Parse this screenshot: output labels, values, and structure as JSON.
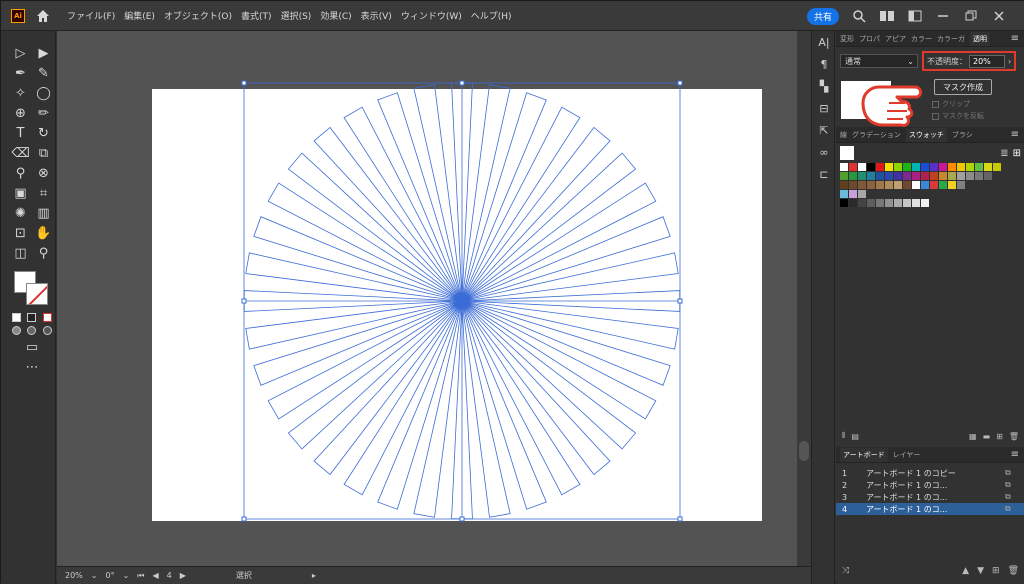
{
  "menubar": {
    "logo": "Ai",
    "items": [
      "ファイル(F)",
      "編集(E)",
      "オブジェクト(O)",
      "書式(T)",
      "選択(S)",
      "効果(C)",
      "表示(V)",
      "ウィンドウ(W)",
      "ヘルプ(H)"
    ],
    "share": "共有"
  },
  "transparency_panel": {
    "tabs": [
      "変形",
      "プロパ",
      "アピア",
      "カラー",
      "カラーガ",
      "透明"
    ],
    "active_tab": "透明",
    "blend_mode": "通常",
    "opacity_label": "不透明度：",
    "opacity_value": "20%",
    "mask_button": "マスク作成",
    "clip_label": "クリップ",
    "invert_mask_label": "マスクを反転"
  },
  "swatches_panel": {
    "tabs": [
      "線",
      "グラデーション",
      "スウォッチ",
      "ブラシ"
    ],
    "active_tab": "スウォッチ",
    "rows": [
      [
        "#ffffff",
        "#e03030",
        "#ffffff",
        "#000000",
        "#e01818",
        "#f7e000",
        "#8fd400",
        "#18b418",
        "#00b4b4",
        "#1a4ed8",
        "#5a2ec8",
        "#c81898",
        "#ff8a00",
        "#f0c800",
        "#b4d400",
        "#60c040",
        "#d8d818",
        "#c8c800"
      ],
      [
        "#50a030",
        "#289840",
        "#209070",
        "#2080a0",
        "#2050a0",
        "#2848b0",
        "#4030a0",
        "#802890",
        "#a82080",
        "#b02050",
        "#c04020",
        "#c88828",
        "#a8a850",
        "#a0a0a0",
        "#8c8c8c",
        "#787878",
        "#646464"
      ],
      [
        "#604020",
        "#6c4a2c",
        "#80583a",
        "#8c6240",
        "#a07848",
        "#b08a58",
        "#c0a070",
        "#704830",
        "#ffffff",
        "#3a88d8",
        "#d83a3a",
        "#28a848",
        "#f0d020",
        "#808080"
      ],
      [
        "#6abadc",
        "#c8a0e0",
        "#a8a8a8"
      ],
      [
        "#000000",
        "#2a2a2a",
        "#444444",
        "#5e5e5e",
        "#787878",
        "#929292",
        "#acacac",
        "#c6c6c6",
        "#e0e0e0",
        "#f0f0f0"
      ]
    ]
  },
  "layers_panel": {
    "tabs": [
      "アートボード",
      "レイヤー"
    ],
    "active_tab": "アートボード",
    "rows": [
      {
        "num": "1",
        "name": "アートボード 1 のコピー"
      },
      {
        "num": "2",
        "name": "アートボード 1 のコ..."
      },
      {
        "num": "3",
        "name": "アートボード 1 のコ..."
      },
      {
        "num": "4",
        "name": "アートボード 1 のコ..."
      }
    ],
    "selected_index": 3
  },
  "statusbar": {
    "zoom": "20%",
    "rotation": "0°",
    "artboard": "4",
    "tool": "選択"
  },
  "colors": {
    "accent": "#1473e6",
    "highlight": "#e03a2c",
    "burst": "#3b6cd6"
  }
}
